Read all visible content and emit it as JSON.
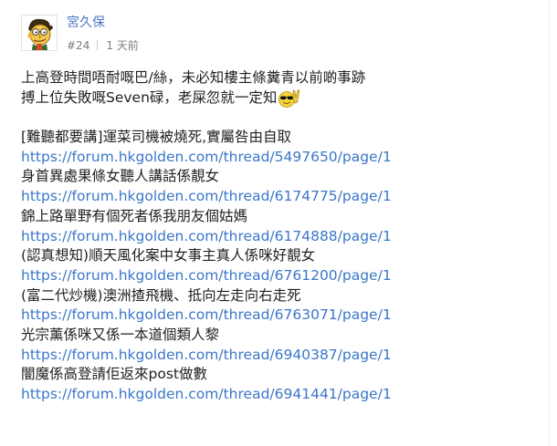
{
  "post": {
    "username": "宮久保",
    "post_number": "#24",
    "time": "1 天前",
    "avatar_icon": "avatar-cartoon-man-icon",
    "emoji_icon": "sunglasses-peace-emoji-icon",
    "content": {
      "intro_line1": "上高登時間唔耐嘅巴/絲，未必知樓主條糞青以前啲事跡",
      "intro_line2": "搏上位失敗嘅Seven碌，老屎忽就一定知",
      "threads": [
        {
          "title": "[難聽都要講]運菜司機被燒死,實屬咎由自取",
          "url": "https://forum.hkgolden.com/thread/5497650/page/1"
        },
        {
          "title": "身首異處果條女聽人講話係靚女",
          "url": "https://forum.hkgolden.com/thread/6174775/page/1"
        },
        {
          "title": "錦上路單野有個死者係我朋友個姑媽",
          "url": "https://forum.hkgolden.com/thread/6174888/page/1"
        },
        {
          "title": "(認真想知)順天風化案中女事主真人係咪好靚女",
          "url": "https://forum.hkgolden.com/thread/6761200/page/1"
        },
        {
          "title": "(富二代炒機)澳洲揸飛機、抵向左走向右走死",
          "url": "https://forum.hkgolden.com/thread/6763071/page/1"
        },
        {
          "title": "光宗薰係咪又係一本道個類人黎",
          "url": "https://forum.hkgolden.com/thread/6940387/page/1"
        },
        {
          "title": "闇魔係高登請佢返來post做數",
          "url": "https://forum.hkgolden.com/thread/6941441/page/1"
        }
      ]
    }
  }
}
